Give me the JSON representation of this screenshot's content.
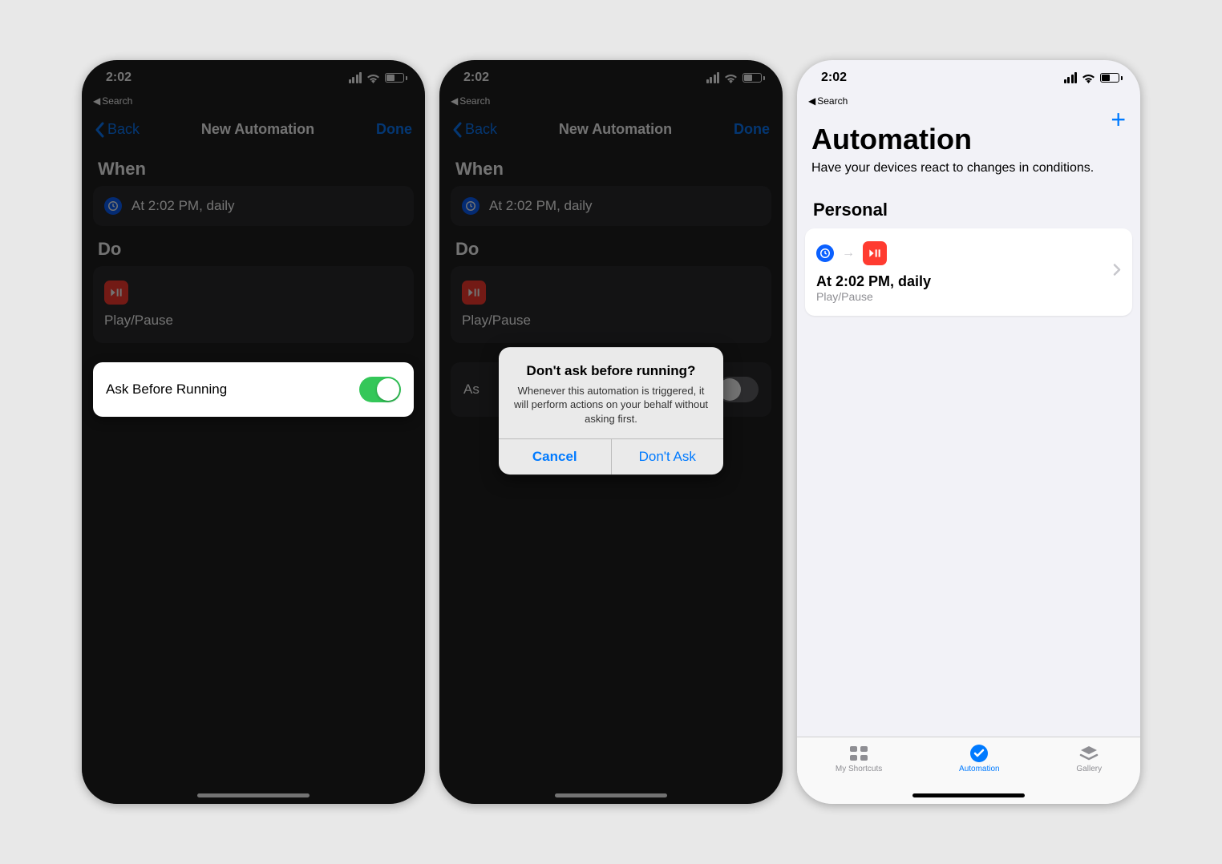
{
  "status": {
    "time": "2:02",
    "back_search": "Search"
  },
  "screen1": {
    "nav_back": "Back",
    "nav_title": "New Automation",
    "nav_done": "Done",
    "when_header": "When",
    "when_text": "At 2:02 PM, daily",
    "do_header": "Do",
    "do_action": "Play/Pause",
    "ask_label": "Ask Before Running"
  },
  "screen2": {
    "nav_back": "Back",
    "nav_title": "New Automation",
    "nav_done": "Done",
    "when_header": "When",
    "when_text": "At 2:02 PM, daily",
    "do_header": "Do",
    "do_action": "Play/Pause",
    "ask_dim_label": "As",
    "alert_title": "Don't ask before running?",
    "alert_msg": "Whenever this automation is triggered, it will perform actions on your behalf without asking first.",
    "alert_cancel": "Cancel",
    "alert_confirm": "Don't Ask"
  },
  "screen3": {
    "title": "Automation",
    "subtitle": "Have your devices react to changes in conditions.",
    "section": "Personal",
    "card_title": "At 2:02 PM, daily",
    "card_sub": "Play/Pause",
    "tab1": "My Shortcuts",
    "tab2": "Automation",
    "tab3": "Gallery"
  }
}
